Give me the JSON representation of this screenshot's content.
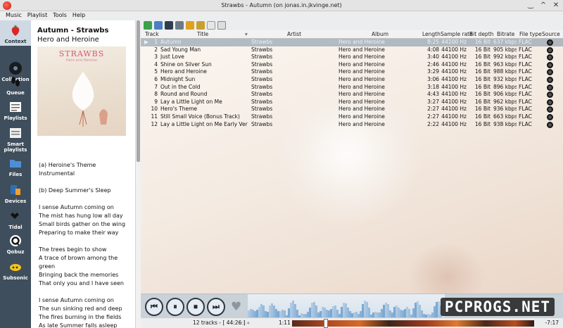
{
  "window": {
    "title": "Strawbs - Autumn (on jonas.in.jkvinge.net)"
  },
  "menu": [
    "Music",
    "Playlist",
    "Tools",
    "Help"
  ],
  "sidebar": [
    {
      "label": "Context"
    },
    {
      "label": "Collection"
    },
    {
      "label": "Queue"
    },
    {
      "label": "Playlists"
    },
    {
      "label": "Smart playlists"
    },
    {
      "label": "Files"
    },
    {
      "label": "Devices"
    },
    {
      "label": "Tidal"
    },
    {
      "label": "Qobuz"
    },
    {
      "label": "Subsonic"
    }
  ],
  "context": {
    "title": "Autumn - Strawbs",
    "album": "Hero and Heroine",
    "cover_text": "STRAWBS",
    "cover_sub": "Hero and Heroine",
    "lyrics": [
      "(a) Heroine's Theme\nInstrumental",
      "(b) Deep Summer's Sleep",
      "I sense Autumn coming on\nThe mist has hung low all day\nSmall birds gather on the wing\nPreparing to make their way",
      "The trees begin to show\nA trace of brown among the green\nBringing back the memories\nThat only you and I have seen",
      "I sense Autumn coming on\nThe sun sinking red and deep\nThe fires burning in the fields\nAs late Summer falls asleep"
    ]
  },
  "columns": {
    "track": "Track",
    "title": "Title",
    "artist": "Artist",
    "album": "Album",
    "length": "Length",
    "samplerate": "Sample rate",
    "bitdepth": "Bit depth",
    "bitrate": "Bitrate",
    "filetype": "File type",
    "source": "Source"
  },
  "tracks": [
    {
      "n": "1",
      "title": "Autumn",
      "artist": "Strawbs",
      "album": "Hero and Heroine",
      "length": "8:25",
      "sr": "44100 Hz",
      "bd": "16 Bit",
      "br": "637 kbps",
      "ft": "FLAC"
    },
    {
      "n": "2",
      "title": "Sad Young Man",
      "artist": "Strawbs",
      "album": "Hero and Heroine",
      "length": "4:08",
      "sr": "44100 Hz",
      "bd": "16 Bit",
      "br": "905 kbps",
      "ft": "FLAC"
    },
    {
      "n": "3",
      "title": "Just Love",
      "artist": "Strawbs",
      "album": "Hero and Heroine",
      "length": "3:40",
      "sr": "44100 Hz",
      "bd": "16 Bit",
      "br": "992 kbps",
      "ft": "FLAC"
    },
    {
      "n": "4",
      "title": "Shine on Silver Sun",
      "artist": "Strawbs",
      "album": "Hero and Heroine",
      "length": "2:46",
      "sr": "44100 Hz",
      "bd": "16 Bit",
      "br": "963 kbps",
      "ft": "FLAC"
    },
    {
      "n": "5",
      "title": "Hero and Heroine",
      "artist": "Strawbs",
      "album": "Hero and Heroine",
      "length": "3:29",
      "sr": "44100 Hz",
      "bd": "16 Bit",
      "br": "988 kbps",
      "ft": "FLAC"
    },
    {
      "n": "6",
      "title": "Midnight Sun",
      "artist": "Strawbs",
      "album": "Hero and Heroine",
      "length": "3:06",
      "sr": "44100 Hz",
      "bd": "16 Bit",
      "br": "932 kbps",
      "ft": "FLAC"
    },
    {
      "n": "7",
      "title": "Out in the Cold",
      "artist": "Strawbs",
      "album": "Hero and Heroine",
      "length": "3:18",
      "sr": "44100 Hz",
      "bd": "16 Bit",
      "br": "896 kbps",
      "ft": "FLAC"
    },
    {
      "n": "8",
      "title": "Round and Round",
      "artist": "Strawbs",
      "album": "Hero and Heroine",
      "length": "4:43",
      "sr": "44100 Hz",
      "bd": "16 Bit",
      "br": "906 kbps",
      "ft": "FLAC"
    },
    {
      "n": "9",
      "title": "Lay a Little Light on Me",
      "artist": "Strawbs",
      "album": "Hero and Heroine",
      "length": "3:27",
      "sr": "44100 Hz",
      "bd": "16 Bit",
      "br": "962 kbps",
      "ft": "FLAC"
    },
    {
      "n": "10",
      "title": "Hero's Theme",
      "artist": "Strawbs",
      "album": "Hero and Heroine",
      "length": "2:27",
      "sr": "44100 Hz",
      "bd": "16 Bit",
      "br": "936 kbps",
      "ft": "FLAC"
    },
    {
      "n": "11",
      "title": "Still Small Voice (Bonus Track)",
      "artist": "Strawbs",
      "album": "Hero and Heroine",
      "length": "2:27",
      "sr": "44100 Hz",
      "bd": "16 Bit",
      "br": "663 kbps",
      "ft": "FLAC"
    },
    {
      "n": "12",
      "title": "Lay a Little Light on Me Early Ver (B…",
      "artist": "Strawbs",
      "album": "Hero and Heroine",
      "length": "2:22",
      "sr": "44100 Hz",
      "bd": "16 Bit",
      "br": "938 kbps",
      "ft": "FLAC"
    }
  ],
  "controls": {
    "prev": "⏮",
    "pause": "⏸",
    "stop": "⏹",
    "next": "⏭",
    "heart": "♥"
  },
  "watermark": "PCPROGS.NET",
  "status": {
    "count": "12 tracks - [ 44:26 ]",
    "elapsed": "1:11",
    "remaining": "-7:17",
    "seek_fraction": 0.14
  }
}
